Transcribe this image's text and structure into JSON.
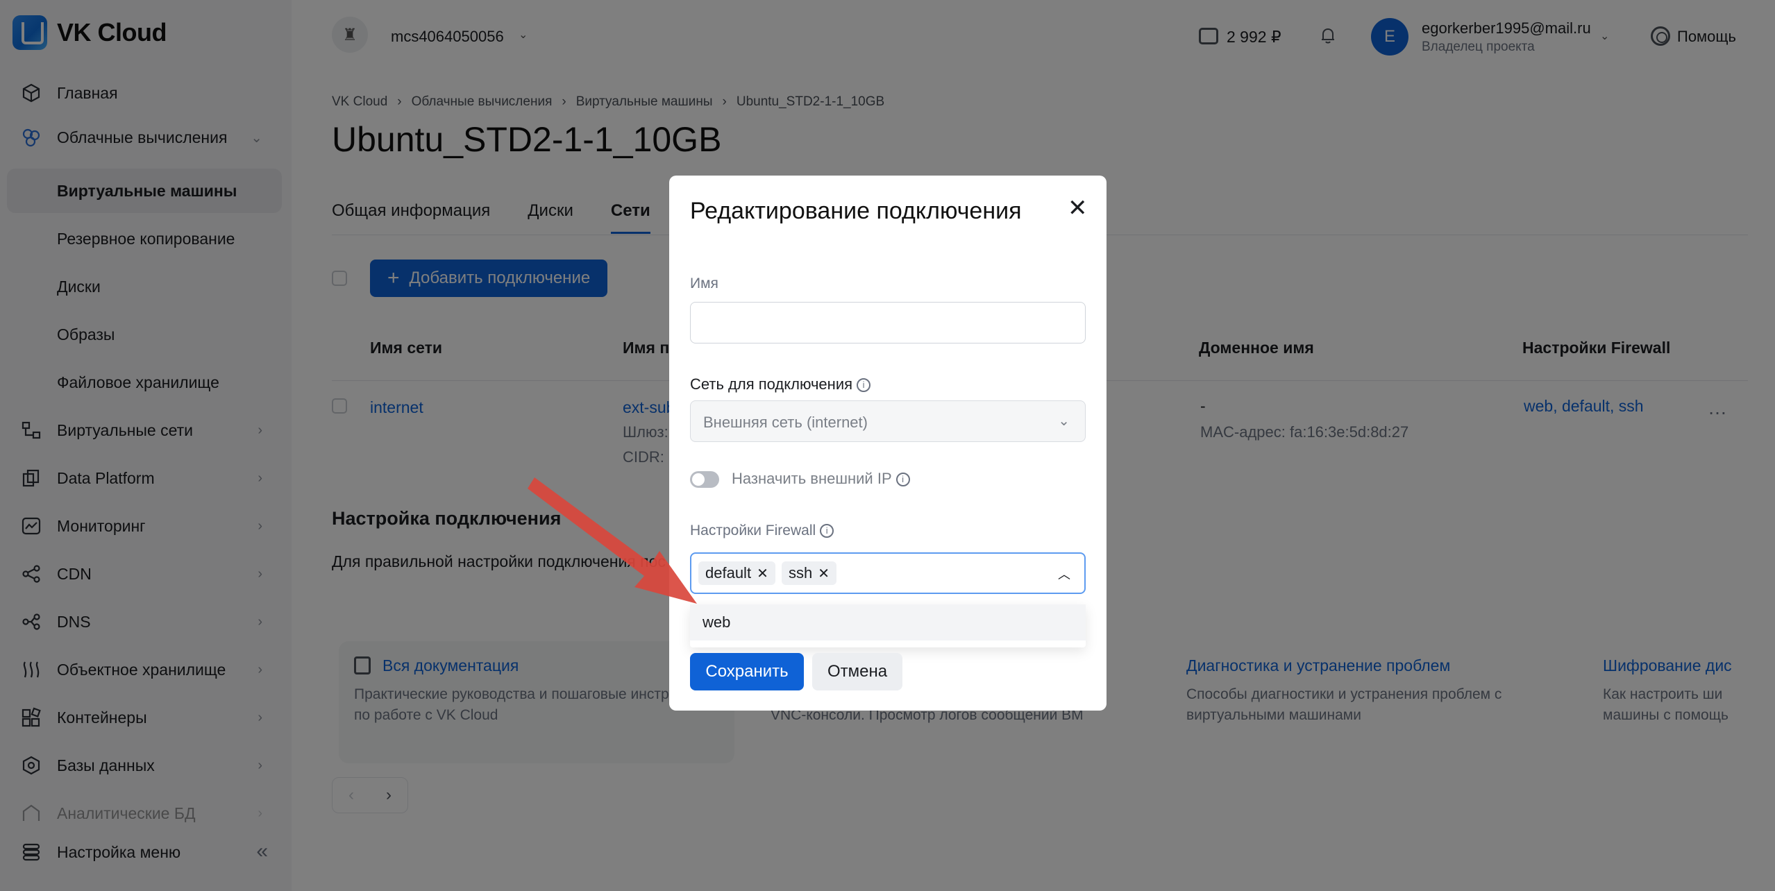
{
  "brand": {
    "name": "VK Cloud"
  },
  "sidebar": {
    "items": [
      {
        "label": "Главная",
        "icon": "cube-icon",
        "chevron": ""
      },
      {
        "label": "Облачные вычисления",
        "icon": "cloud-compute-icon",
        "chevron": "⌄"
      },
      {
        "label": "Виртуальные сети",
        "icon": "network-icon",
        "chevron": "›"
      },
      {
        "label": "Data Platform",
        "icon": "data-platform-icon",
        "chevron": "›"
      },
      {
        "label": "Мониторинг",
        "icon": "monitoring-icon",
        "chevron": "›"
      },
      {
        "label": "CDN",
        "icon": "cdn-icon",
        "chevron": "›"
      },
      {
        "label": "DNS",
        "icon": "dns-icon",
        "chevron": "›"
      },
      {
        "label": "Объектное хранилище",
        "icon": "object-storage-icon",
        "chevron": "›"
      },
      {
        "label": "Контейнеры",
        "icon": "containers-icon",
        "chevron": "›"
      },
      {
        "label": "Базы данных",
        "icon": "databases-icon",
        "chevron": "›"
      },
      {
        "label": "Аналитические БД",
        "icon": "analytics-db-icon",
        "chevron": "›"
      }
    ],
    "subitems": [
      {
        "label": "Виртуальные машины",
        "active": true
      },
      {
        "label": "Резервное копирование"
      },
      {
        "label": "Диски"
      },
      {
        "label": "Образы"
      },
      {
        "label": "Файловое хранилище"
      }
    ],
    "footer": {
      "label": "Настройка меню",
      "collapse": "«"
    }
  },
  "topbar": {
    "project": "mcs4064050056",
    "balance": "2 992 ₽",
    "user": {
      "initial": "E",
      "email": "egorkerber1995@mail.ru",
      "role": "Владелец проекта"
    },
    "help": "Помощь"
  },
  "breadcrumb": [
    "VK Cloud",
    "Облачные вычисления",
    "Виртуальные машины",
    "Ubuntu_STD2-1-1_10GB"
  ],
  "page": {
    "title": "Ubuntu_STD2-1-1_10GB"
  },
  "tabs": [
    "Общая информация",
    "Диски",
    "Сети"
  ],
  "actions": {
    "add_connection": "Добавить подключение"
  },
  "table": {
    "headers": {
      "network": "Имя сети",
      "subnet": "Имя подсети",
      "domain": "Доменное имя",
      "firewall": "Настройки Firewall"
    },
    "row": {
      "network": "internet",
      "subnet": "ext-sub",
      "gateway": "Шлюз:",
      "cidr": "CIDR:",
      "domain": "-",
      "mac": "MAC-адрес: fa:16:3e:5d:8d:27",
      "firewall": "web, default, ssh",
      "more": "…"
    }
  },
  "connection_section": {
    "title": "Настройка подключения",
    "text": "Для правильной настройки подключения пос"
  },
  "docs": [
    {
      "title": "Вся документация",
      "desc": "Практические руководства и пошаговые инструкции по работе с VK Cloud"
    },
    {
      "title": "",
      "desc": "VNC-консоли. Просмотр логов сообщений ВМ"
    },
    {
      "title": "Диагностика и устранение проблем",
      "desc": "Способы диагностики и устранения проблем с виртуальными машинами"
    },
    {
      "title": "Шифрование дис",
      "desc": "Как настроить ши машины с помощь"
    }
  ],
  "pager": {
    "prev": "‹",
    "next": "›"
  },
  "modal": {
    "title": "Редактирование подключения",
    "close": "✕",
    "name_label": "Имя",
    "name_value": "",
    "network_label": "Сеть для подключения",
    "network_value": "Внешняя сеть (internet)",
    "external_ip_label": "Назначить внешний IP",
    "firewall_label": "Настройки Firewall",
    "firewall_selected": [
      "default",
      "ssh"
    ],
    "firewall_option": "web",
    "save": "Сохранить",
    "cancel": "Отмена"
  },
  "colors": {
    "accent": "#0f62d6",
    "arrow": "#d9463c"
  }
}
